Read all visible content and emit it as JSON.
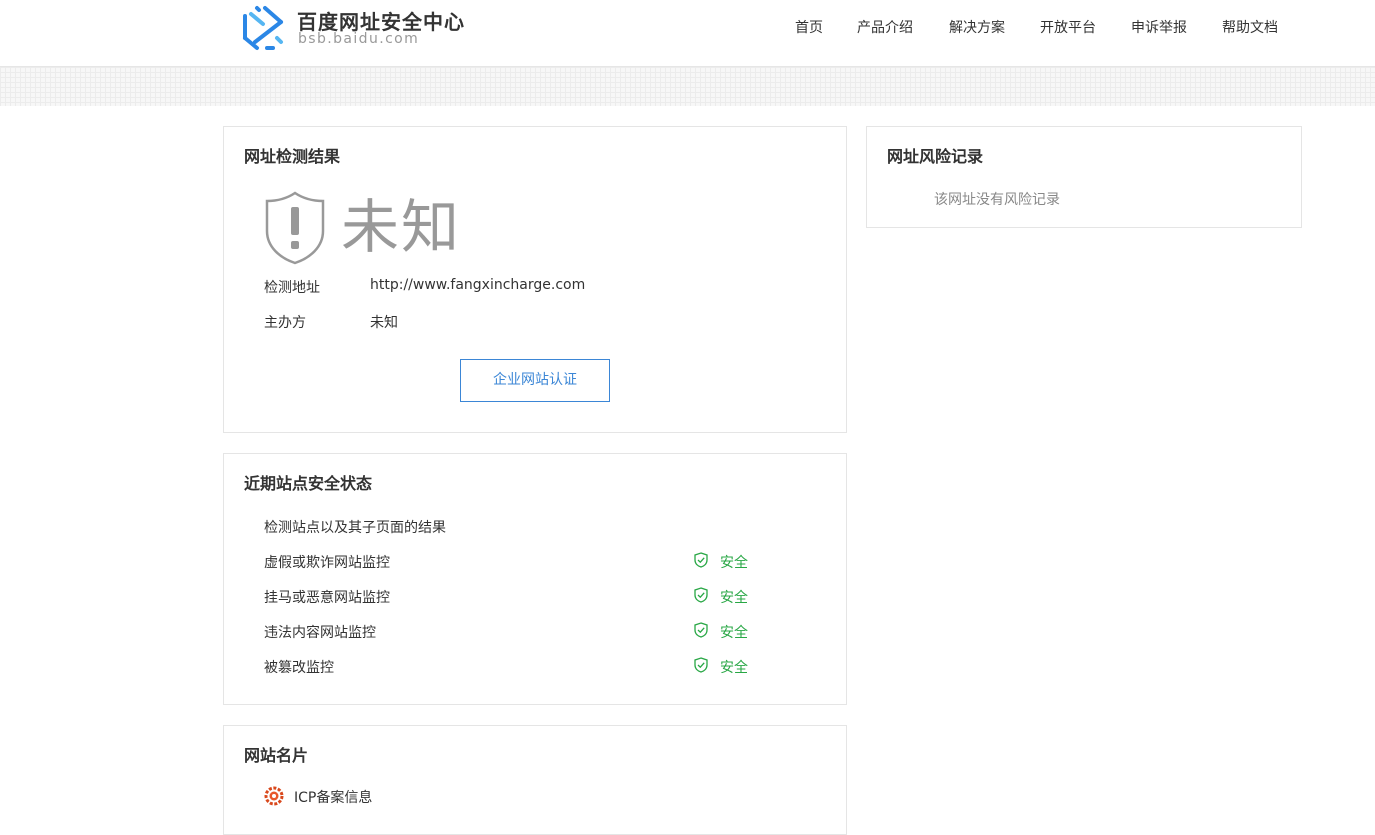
{
  "header": {
    "brand_title": "百度网址安全中心",
    "brand_domain": "bsb.baidu.com",
    "logo_icon": "baidu-security-logo-icon",
    "nav": [
      "首页",
      "产品介绍",
      "解决方案",
      "开放平台",
      "申诉举报",
      "帮助文档"
    ]
  },
  "result_card": {
    "title": "网址检测结果",
    "status_icon": "shield-exclamation-icon",
    "status_text": "未知",
    "rows": [
      {
        "label": "检测地址",
        "value": "http://www.fangxincharge.com"
      },
      {
        "label": "主办方",
        "value": "未知"
      }
    ],
    "cert_button": "企业网站认证"
  },
  "status_card": {
    "title": "近期站点安全状态",
    "intro": "检测站点以及其子页面的结果",
    "items": [
      {
        "label": "虚假或欺诈网站监控",
        "value": "安全",
        "icon": "shield-check-icon"
      },
      {
        "label": "挂马或恶意网站监控",
        "value": "安全",
        "icon": "shield-check-icon"
      },
      {
        "label": "违法内容网站监控",
        "value": "安全",
        "icon": "shield-check-icon"
      },
      {
        "label": "被篡改监控",
        "value": "安全",
        "icon": "shield-check-icon"
      }
    ]
  },
  "card_card": {
    "title": "网站名片",
    "icp_icon": "icp-badge-icon",
    "icp_label": "ICP备案信息"
  },
  "risk_card": {
    "title": "网址风险记录",
    "empty_text": "该网址没有风险记录"
  },
  "colors": {
    "accent": "#3b86d6",
    "safe": "#28a745",
    "muted": "#999999"
  }
}
